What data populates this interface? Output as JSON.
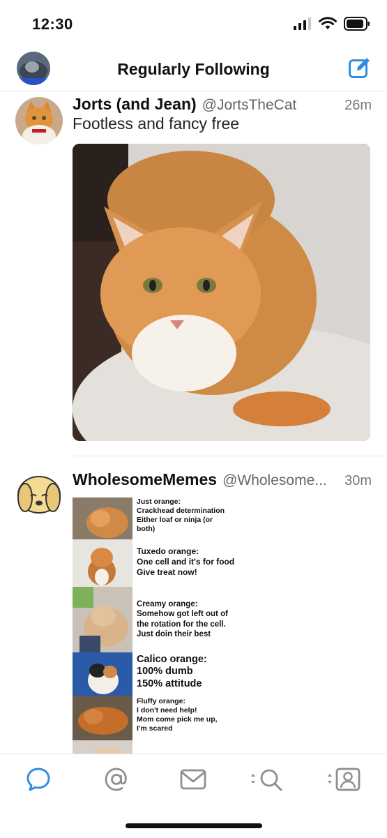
{
  "status": {
    "time": "12:30"
  },
  "header": {
    "title": "Regularly Following"
  },
  "tweets": [
    {
      "name": "Jorts (and Jean)",
      "handle": "@JortsTheCat",
      "time": "26m",
      "text": "Footless and fancy free"
    },
    {
      "name": "WholesomeMemes",
      "handle": "@Wholesome...",
      "time": "30m",
      "meme": [
        {
          "lines": [
            "Just orange:",
            "Crackhead determination",
            "Either loaf or ninja (or",
            "both)"
          ]
        },
        {
          "lines": [
            "Tuxedo orange:",
            "One cell and it's for food",
            "Give treat now!"
          ]
        },
        {
          "lines": [
            "Creamy orange:",
            "Somehow got left out of",
            "the rotation for the cell.",
            "Just doin their best"
          ]
        },
        {
          "lines": [
            "Calico orange:",
            "100% dumb",
            "150% attitude"
          ]
        },
        {
          "lines": [
            "Fluffy orange:",
            "I don't need help!",
            "Mom come pick me up,",
            "I'm scared"
          ]
        }
      ]
    }
  ],
  "tabbar": {
    "items": [
      {
        "icon": "speech-bubble-icon",
        "active": true
      },
      {
        "icon": "at-sign-icon"
      },
      {
        "icon": "envelope-icon"
      },
      {
        "icon": "search-icon"
      },
      {
        "icon": "profile-icon"
      }
    ]
  },
  "colors": {
    "accent": "#2f8ee0",
    "icon_gray": "#8e8e93",
    "divider": "#e6e6e6"
  }
}
